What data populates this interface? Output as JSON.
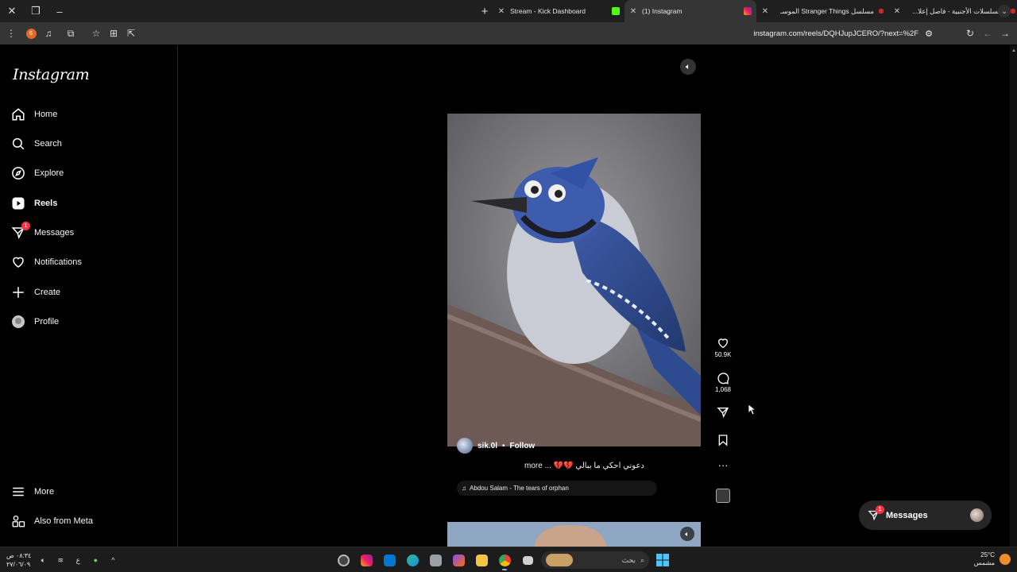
{
  "browser": {
    "tabs": [
      {
        "title": "Stream - Kick Dashboard",
        "active": false
      },
      {
        "title": "(1) Instagram",
        "active": true
      },
      {
        "title": "مسلسل Stranger Things الموسـ",
        "active": false
      },
      {
        "title": "المسلسلات الأجنبية - فاصل إعلا...",
        "active": false
      }
    ],
    "url": "instagram.com/reels/DQHJupJCERO/?next=%2F",
    "extension_badge": "6"
  },
  "sidebar": {
    "logo": "Instagram",
    "items": [
      {
        "label": "Home",
        "icon": "home-icon"
      },
      {
        "label": "Search",
        "icon": "search-icon"
      },
      {
        "label": "Explore",
        "icon": "compass-icon"
      },
      {
        "label": "Reels",
        "icon": "reels-icon"
      },
      {
        "label": "Messages",
        "icon": "messenger-icon",
        "badge": "1"
      },
      {
        "label": "Notifications",
        "icon": "heart-icon"
      },
      {
        "label": "Create",
        "icon": "plus-icon"
      },
      {
        "label": "Profile",
        "icon": "avatar"
      }
    ],
    "bottom": [
      {
        "label": "More",
        "icon": "menu-icon"
      },
      {
        "label": "Also from Meta",
        "icon": "meta-icon"
      }
    ]
  },
  "reel": {
    "username": "sik.0l",
    "separator": "•",
    "follow_label": "Follow",
    "caption": "دعوني احكي ما ببالي 💔💔 ... more",
    "music": "Abdou Salam - The tears of orphan",
    "likes": "50.9K",
    "comments": "1,068"
  },
  "messages_pill": {
    "label": "Messages",
    "badge": "1"
  },
  "taskbar": {
    "time": "٠٨:٣٤ ص",
    "date": "٢٧/٠٦/٠٩",
    "lang": "ع",
    "search_label": "بحث",
    "weather_temp": "25°C",
    "weather_desc": "مشمس"
  }
}
